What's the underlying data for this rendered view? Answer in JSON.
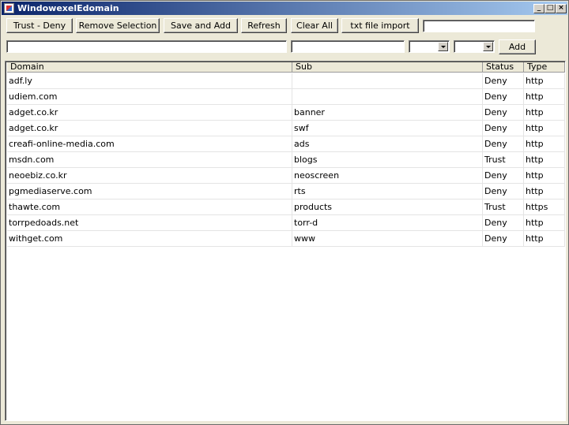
{
  "window": {
    "title": "WindowexelEdomain"
  },
  "toolbar": {
    "trust_deny": "Trust - Deny",
    "remove_selection": "Remove Selection",
    "save_and_add": "Save and Add",
    "refresh": "Refresh",
    "clear_all": "Clear All",
    "txt_import": "txt file import",
    "import_value": ""
  },
  "entry": {
    "domain": "",
    "sub": "",
    "status": "",
    "type": "",
    "add": "Add"
  },
  "table": {
    "columns": [
      "Domain",
      "Sub",
      "Status",
      "Type"
    ],
    "rows": [
      [
        "adf.ly",
        "",
        "Deny",
        "http"
      ],
      [
        "udiem.com",
        "",
        "Deny",
        "http"
      ],
      [
        "adget.co.kr",
        "banner",
        "Deny",
        "http"
      ],
      [
        "adget.co.kr",
        "swf",
        "Deny",
        "http"
      ],
      [
        "creafi-online-media.com",
        "ads",
        "Deny",
        "http"
      ],
      [
        "msdn.com",
        "blogs",
        "Trust",
        "http"
      ],
      [
        "neoebiz.co.kr",
        "neoscreen",
        "Deny",
        "http"
      ],
      [
        "pgmediaserve.com",
        "rts",
        "Deny",
        "http"
      ],
      [
        "thawte.com",
        "products",
        "Trust",
        "https"
      ],
      [
        "torrpedoads.net",
        "torr-d",
        "Deny",
        "http"
      ],
      [
        "withget.com",
        "www",
        "Deny",
        "http"
      ]
    ]
  }
}
